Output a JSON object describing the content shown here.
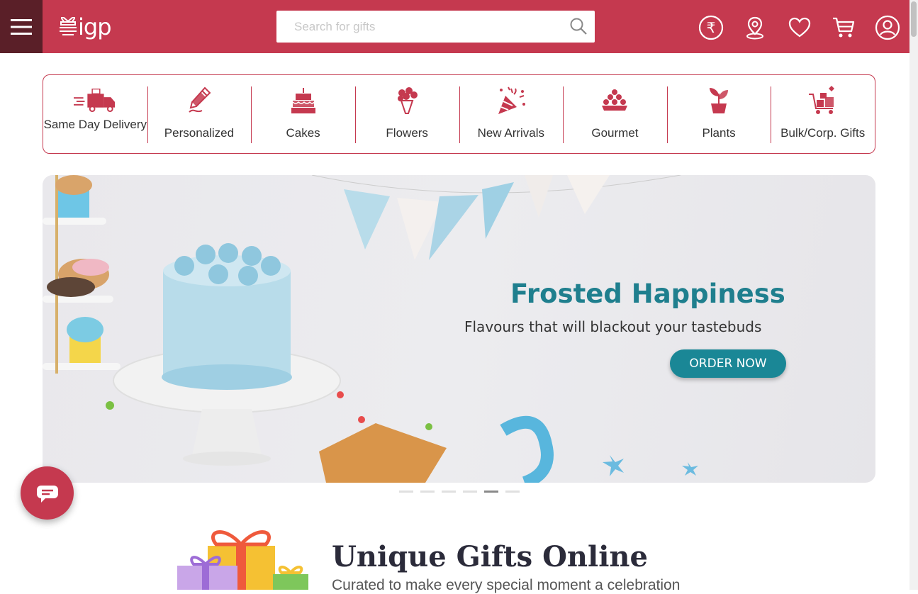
{
  "header": {
    "logo_text": "igp",
    "search": {
      "placeholder": "Search for gifts",
      "value": ""
    },
    "icons": [
      "menu-icon",
      "rupee-icon",
      "location-pin-icon",
      "heart-icon",
      "cart-icon",
      "account-icon"
    ]
  },
  "categories": [
    {
      "label": "Same Day Delivery",
      "icon": "delivery-truck-icon"
    },
    {
      "label": "Personalized",
      "icon": "pencil-icon"
    },
    {
      "label": "Cakes",
      "icon": "cake-icon"
    },
    {
      "label": "Flowers",
      "icon": "bouquet-icon"
    },
    {
      "label": "New Arrivals",
      "icon": "party-popper-icon"
    },
    {
      "label": "Gourmet",
      "icon": "sweets-platter-icon"
    },
    {
      "label": "Plants",
      "icon": "potted-plant-icon"
    },
    {
      "label": "Bulk/Corp. Gifts",
      "icon": "gift-trolley-icon"
    }
  ],
  "banner": {
    "title": "Frosted Happiness",
    "subtitle": "Flavours that will blackout your tastebuds",
    "cta": "ORDER NOW",
    "slide_count": 6,
    "active_slide": 5
  },
  "section": {
    "title": "Unique Gifts Online",
    "subtitle": "Curated to make every special moment a celebration"
  },
  "colors": {
    "brand": "#c5394f",
    "brand_dark": "#5a1f28",
    "teal": "#1f7f8e"
  }
}
